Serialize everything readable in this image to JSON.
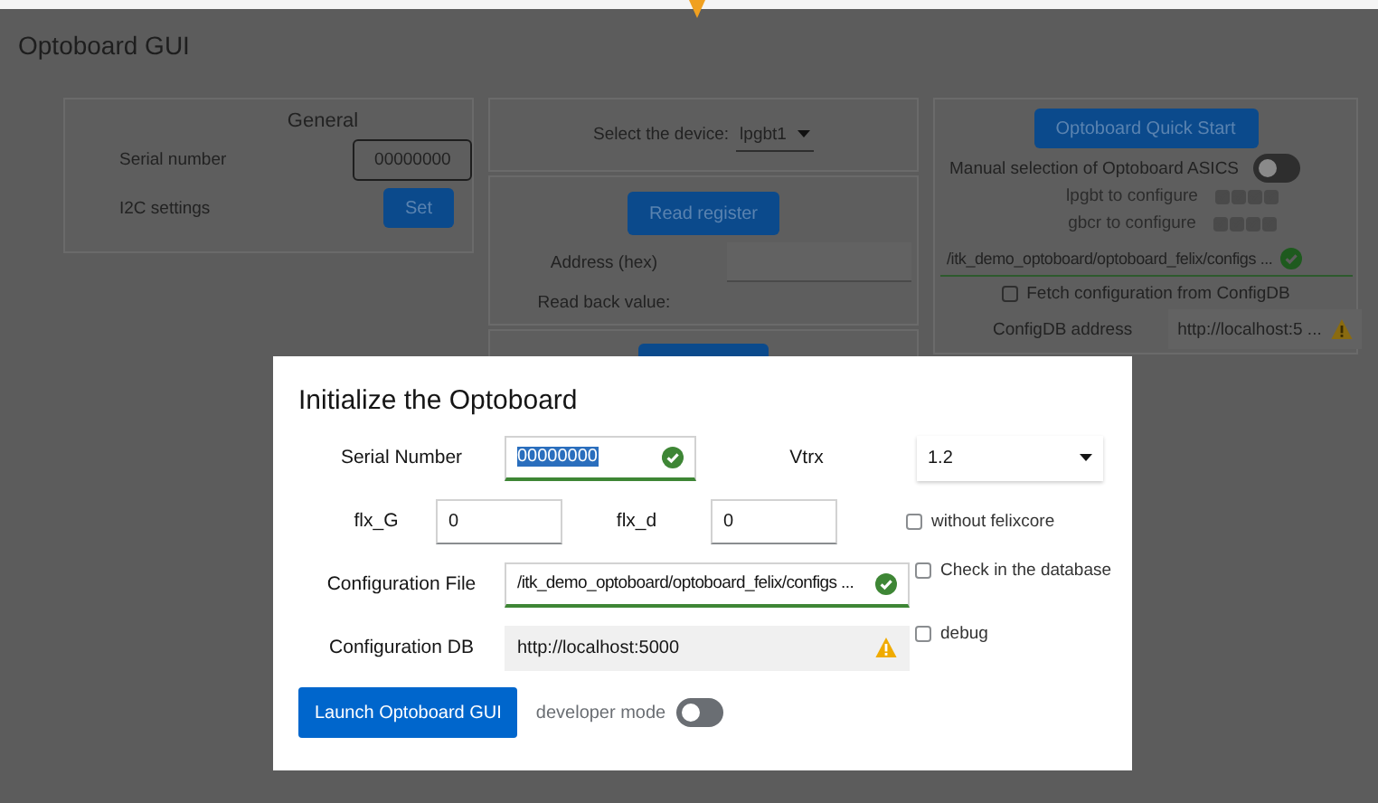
{
  "app": {
    "title": "Optoboard GUI"
  },
  "general": {
    "heading": "General",
    "serial_label": "Serial number",
    "serial_value": "00000000",
    "i2c_label": "I2C settings",
    "set_button": "Set"
  },
  "device": {
    "label": "Select the device:",
    "value": "lpgbt1"
  },
  "register": {
    "button": "Read register",
    "address_label": "Address (hex)",
    "readback_label": "Read back value:"
  },
  "quick_start": {
    "button": "Optoboard Quick Start",
    "manual_label": "Manual selection of Optoboard ASICS",
    "manual_on": false,
    "asic_rows": [
      {
        "label": "lpgbt to configure",
        "disabled": true,
        "checks": [
          {
            "checked": true
          },
          {
            "checked": true
          },
          {
            "checked": true
          },
          {
            "checked": true
          }
        ]
      },
      {
        "label": "gbcr to configure",
        "disabled": true,
        "checks": [
          {
            "checked": true
          },
          {
            "checked": true
          },
          {
            "checked": true
          },
          {
            "checked": true
          }
        ]
      }
    ],
    "config_path": {
      "value": "/itk_demo_optoboard/optoboard_felix/configs ...",
      "valid": true
    },
    "fetch": {
      "label": "Fetch configuration from ConfigDB",
      "checked": false
    },
    "configdb": {
      "label": "ConfigDB address",
      "value": "http://localhost:5 ...",
      "valid": false
    }
  },
  "dialog": {
    "title": "Initialize the Optoboard",
    "serial": {
      "label": "Serial Number",
      "value": "00000000",
      "text_selected": true,
      "valid": true
    },
    "vtrx": {
      "label": "Vtrx",
      "value": "1.2"
    },
    "flx_g": {
      "label": "flx_G",
      "value": "0"
    },
    "flx_d": {
      "label": "flx_d",
      "value": "0"
    },
    "config_file": {
      "label": "Configuration File",
      "value": "/itk_demo_optoboard/optoboard_felix/configs ...",
      "valid": true
    },
    "config_db": {
      "label": "Configuration DB",
      "value": "http://localhost:5000",
      "valid": false
    },
    "options": [
      {
        "label": "without felixcore",
        "checked": false
      },
      {
        "label": "Check in the database",
        "checked": false
      },
      {
        "label": "debug",
        "checked": false
      }
    ],
    "launch_button": "Launch Optoboard GUI",
    "developer_mode": {
      "label": "developer mode",
      "on": false
    }
  }
}
